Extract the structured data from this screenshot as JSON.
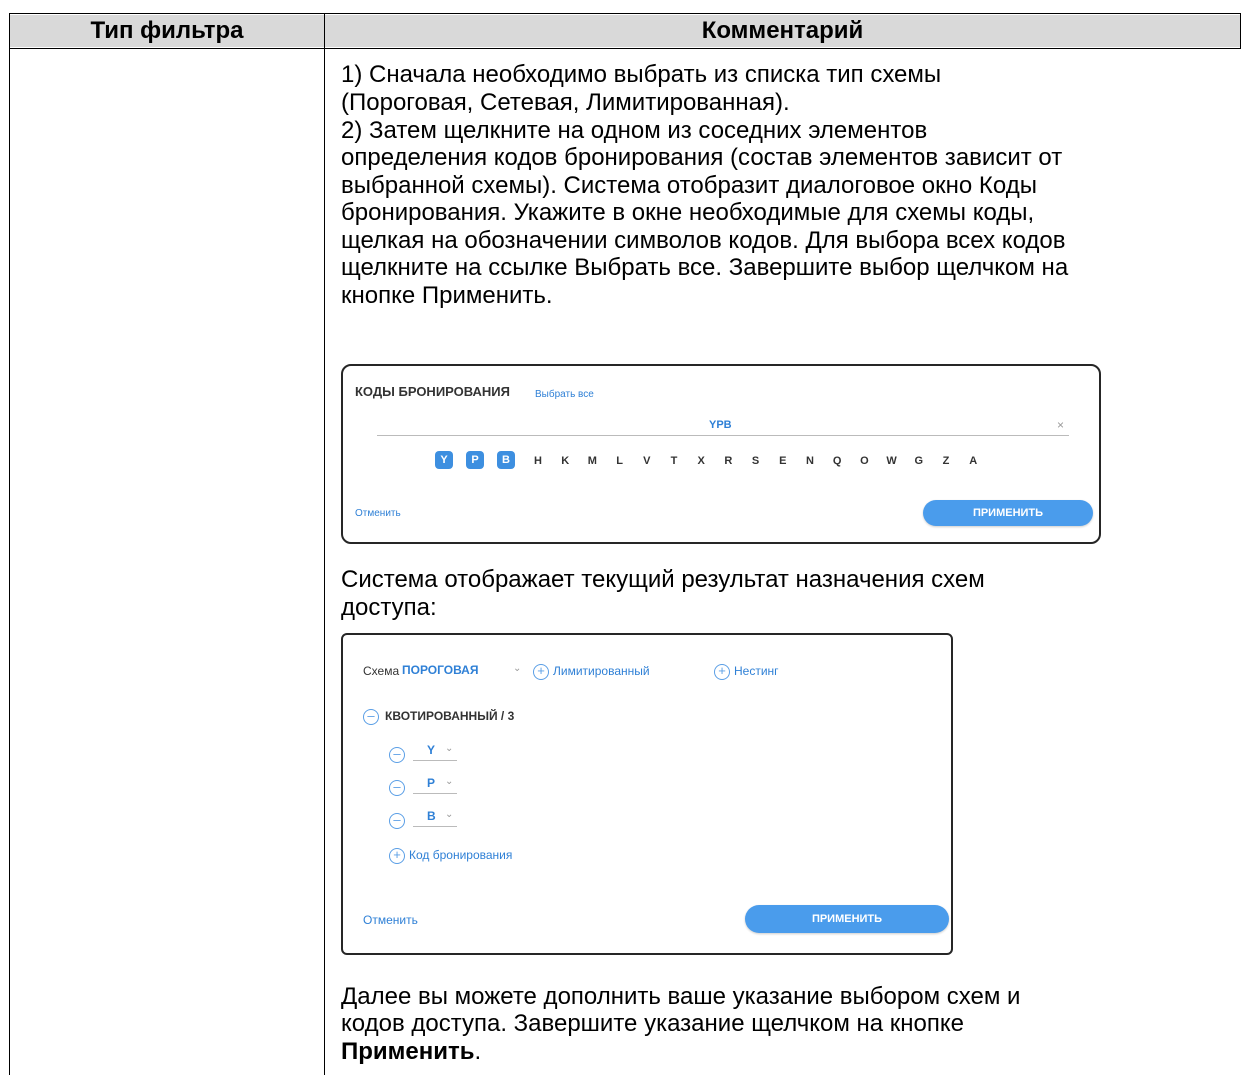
{
  "table": {
    "headers": {
      "filter_type": "Тип фильтра",
      "comment": "Комментарий"
    },
    "paragraphs": [
      "1) Сначала необходимо выбрать из списка тип схемы",
      "(Пороговая, Сетевая, Лимитированная).",
      "2) Затем щелкните на одном из соседних элементов",
      "определения кодов бронирования (состав элементов зависит от",
      "выбранной схемы). Система отобразит диалоговое окно Коды",
      "бронирования. Укажите в окне необходимые для схемы коды,",
      "щелкая на обозначении символов кодов. Для выбора всех кодов",
      "щелкните на ссылке Выбрать все. Завершите выбор щелчком на",
      "кнопке Применить."
    ],
    "paragraph_2": [
      "Система отображает текущий результат назначения схем",
      "доступа:"
    ],
    "paragraph_3": {
      "line1": "Далее вы можете дополнить ваше указание выбором схем и",
      "line2": "кодов доступа. Завершите указание щелчком на кнопке",
      "bold": "Применить",
      "tail": "."
    }
  },
  "dialog_codes": {
    "title": "КОДЫ БРОНИРОВАНИЯ",
    "select_all_link": "Выбрать все",
    "field_value": "YPB",
    "clear_icon": "×",
    "selected_codes": [
      "Y",
      "P",
      "B"
    ],
    "other_codes": [
      "H",
      "K",
      "M",
      "L",
      "V",
      "T",
      "X",
      "R",
      "S",
      "E",
      "N",
      "Q",
      "O",
      "W",
      "G",
      "Z",
      "A"
    ],
    "cancel_link": "Отменить",
    "apply_button": "ПРИМЕНИТЬ"
  },
  "dialog_scheme": {
    "scheme_label": "Схема",
    "scheme_value": "ПОРОГОВАЯ",
    "add_limited": "Лимитированный",
    "add_nesting": "Нестинг",
    "quota_label": "КВОТИРОВАННЫЙ / 3",
    "codes": [
      "Y",
      "P",
      "B"
    ],
    "add_code": "Код бронирования",
    "cancel_link": "Отменить",
    "apply_button": "ПРИМЕНИТЬ",
    "accent_color": "#2f80d6"
  }
}
